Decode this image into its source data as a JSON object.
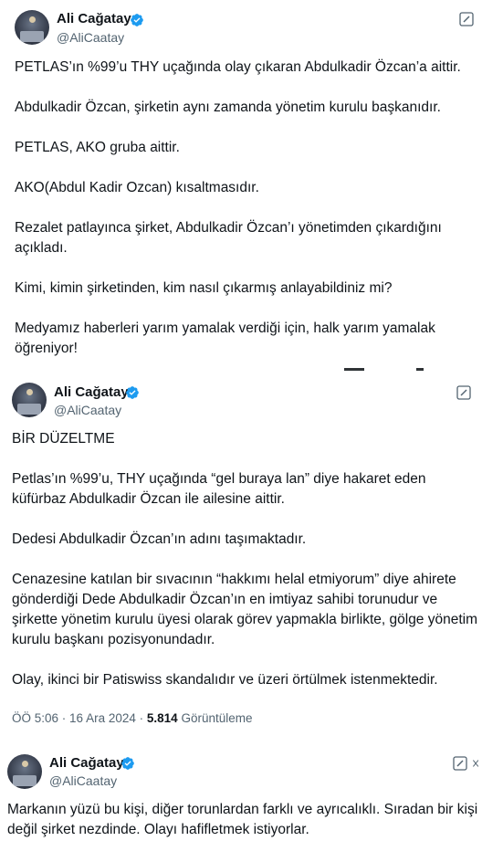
{
  "tweets": [
    {
      "author": "Ali Cağatay",
      "handle": "@AliCaatay",
      "text": "PETLAS’ın %99’u THY uçağında olay çıkaran Abdulkadir Özcan’a aittir.\n\nAbdulkadir Özcan, şirketin aynı zamanda yönetim kurulu başkanıdır.\n\nPETLAS, AKO gruba aittir.\n\nAKO(Abdul Kadir Ozcan) kısaltmasıdır.\n\nRezalet patlayınca şirket, Abdulkadir Özcan’ı yönetimden çıkardığını açıkladı.\n\nKimi, kimin şirketinden, kim nasıl çıkarmış anlayabildiniz mi?\n\nMedyamız haberleri yarım yamalak verdiği için, halk yarım yamalak öğreniyor!"
    },
    {
      "author": "Ali Cağatay",
      "handle": "@AliCaatay",
      "text": "BİR DÜZELTME\n\nPetlas’ın %99’u, THY uçağında “gel buraya lan” diye hakaret eden küfürbaz Abdulkadir Özcan ile ailesine aittir.\n\nDedesi Abdulkadir Özcan’ın adını taşımaktadır.\n\nCenazesine katılan bir sıvacının “hakkımı helal etmiyorum” diye ahirete gönderdiği Dede Abdulkadir Özcan’ın en imtiyaz sahibi torunudur ve şirkette yönetim kurulu üyesi olarak görev yapmakla birlikte, gölge yönetim kurulu başkanı pozisyonundadır.\n\nOlay, ikinci bir Patiswiss skandalıdır ve üzeri örtülmek istenmektedir.",
      "time": "ÖÖ 5:06",
      "date": "16 Ara 2024",
      "views": "5.814",
      "views_label": "Görüntüleme"
    },
    {
      "author": "Ali Cağatay",
      "handle": "@AliCaatay",
      "text": "Markanın yüzü bu kişi, diğer torunlardan farklı ve ayrıcalıklı. Sıradan bir kişi değil şirket nezdinde. Olayı hafifletmek istiyorlar."
    }
  ],
  "colors": {
    "verified": "#1d9bf0",
    "muted": "#536471",
    "text": "#0f1419"
  },
  "icons": {
    "verified": "verified-badge-icon",
    "edit": "edit-icon"
  }
}
